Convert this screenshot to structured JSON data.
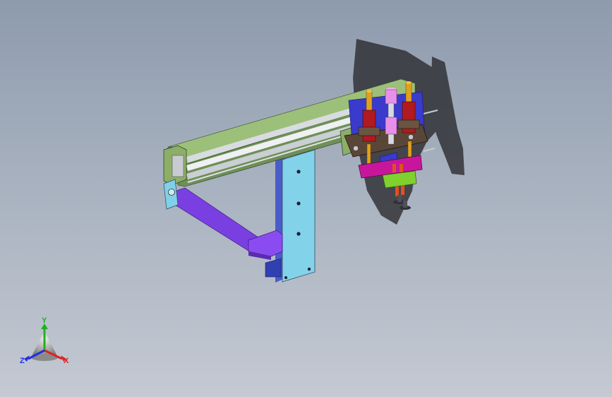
{
  "viewport": {
    "background_top": "#8e9bad",
    "background_bottom": "#c4c9d2"
  },
  "model": {
    "parts": [
      "linear-rail-frame",
      "end-plate-left",
      "end-plate-right",
      "vertical-support-column",
      "diagonal-brace",
      "foot-block",
      "carriage-plate",
      "guide-cylinder-left",
      "guide-cylinder-right",
      "pneumatic-cylinder",
      "mount-plate",
      "gripper-plate",
      "suction-cups"
    ],
    "colors": {
      "rail": "#7f9e62",
      "column": "#7fd0e8",
      "brace": "#7a3fe0",
      "carriage": "#5a4636",
      "cylinder": "#b01a20",
      "rod": "#e0a020",
      "air_cylinder": "#e890e8",
      "mount_plate": "#c8169c",
      "gripper_plate": "#80d030",
      "shadow": "#2e2e33"
    }
  },
  "triad": {
    "x_label": "X",
    "y_label": "Y",
    "z_label": "Z",
    "x_color": "#e02020",
    "y_color": "#20b020",
    "z_color": "#2030e0"
  }
}
